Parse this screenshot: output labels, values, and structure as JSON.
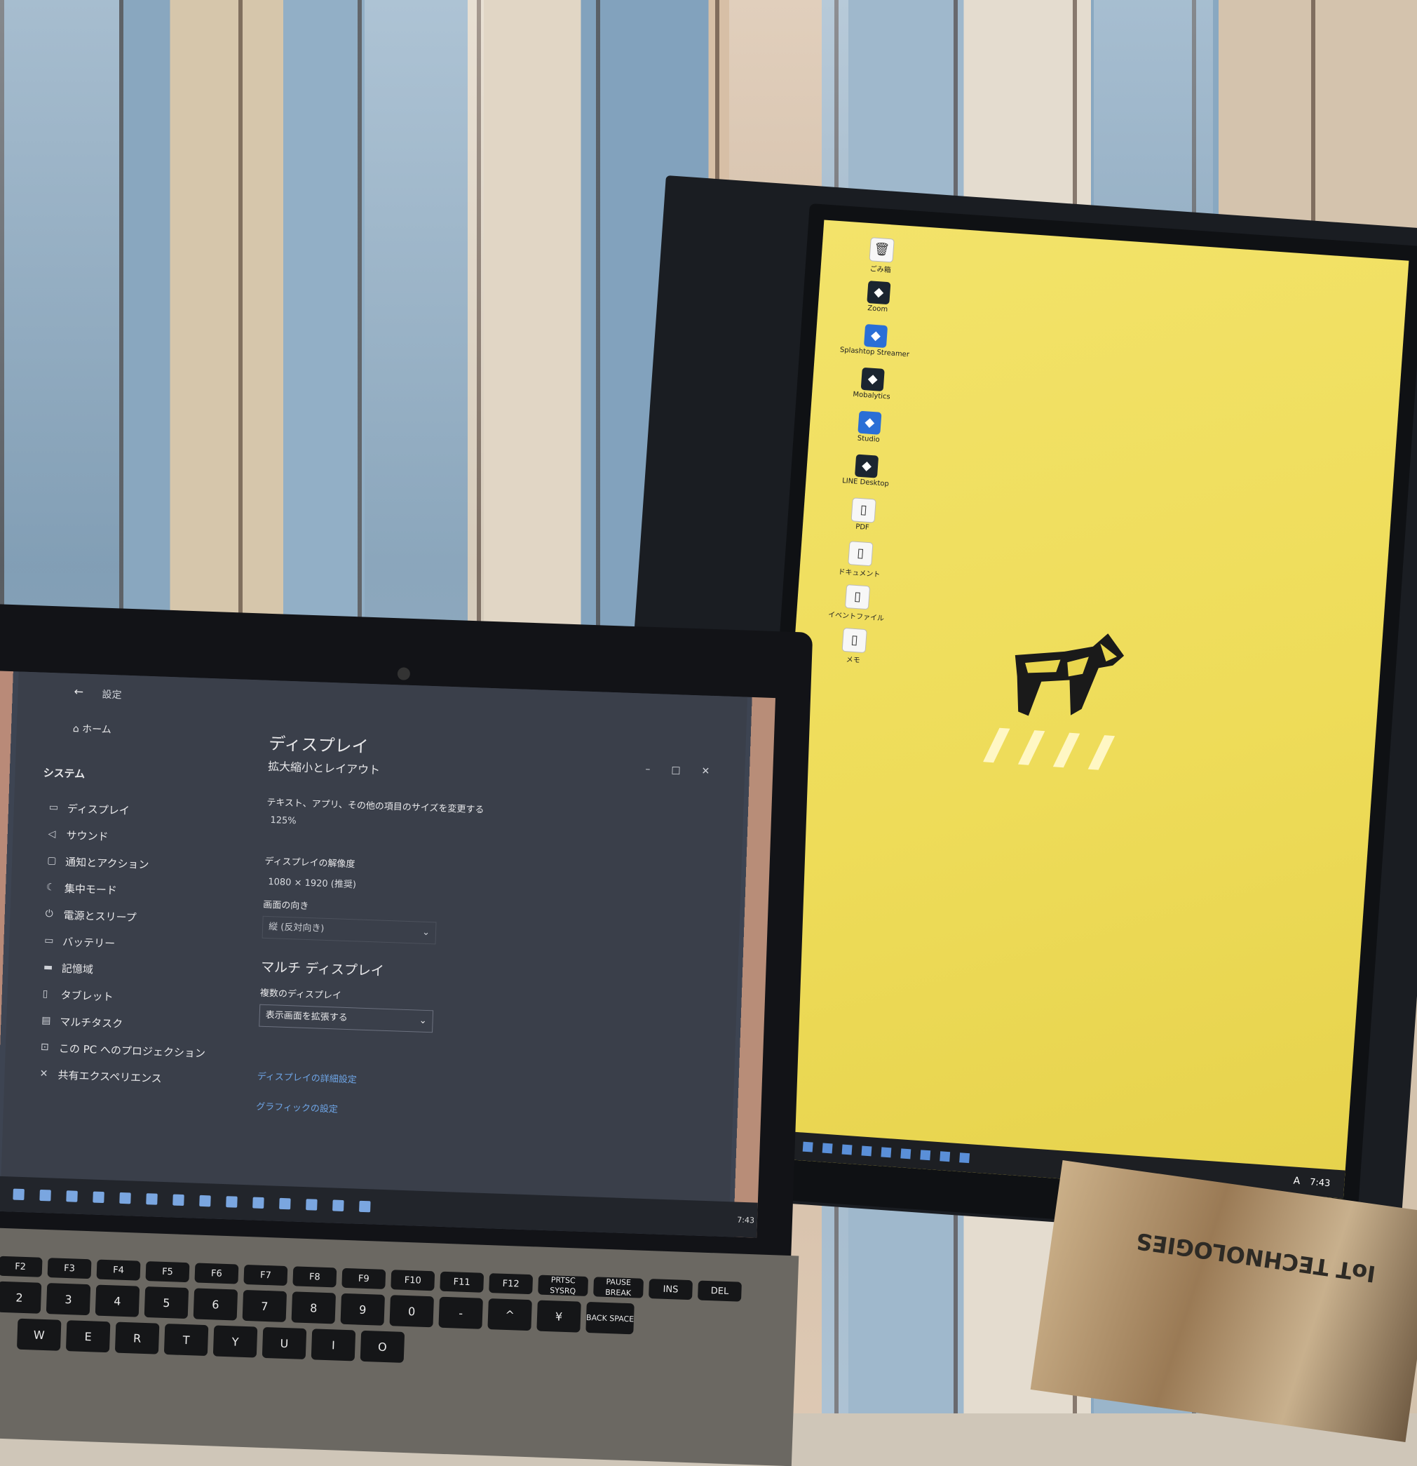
{
  "laptop": {
    "settings": {
      "window_title": "設定",
      "nav": {
        "home": "ホーム",
        "section": "システム",
        "items": [
          {
            "label": "ディスプレイ",
            "icon": "display-icon"
          },
          {
            "label": "サウンド",
            "icon": "speaker-icon"
          },
          {
            "label": "通知とアクション",
            "icon": "notification-icon"
          },
          {
            "label": "集中モード",
            "icon": "moon-icon"
          },
          {
            "label": "電源とスリープ",
            "icon": "power-icon"
          },
          {
            "label": "バッテリー",
            "icon": "battery-icon"
          },
          {
            "label": "記憶域",
            "icon": "storage-icon"
          },
          {
            "label": "タブレット",
            "icon": "tablet-icon"
          },
          {
            "label": "マルチタスク",
            "icon": "multitask-icon"
          },
          {
            "label": "この PC へのプロジェクション",
            "icon": "projection-icon"
          },
          {
            "label": "共有エクスペリエンス",
            "icon": "share-icon"
          }
        ]
      },
      "main": {
        "title": "ディスプレイ",
        "subtitle": "拡大縮小とレイアウト",
        "scale_label": "テキスト、アプリ、その他の項目のサイズを変更する",
        "scale_value": "125%",
        "resolution_label": "ディスプレイの解像度",
        "resolution_value": "1080 × 1920 (推奨)",
        "orientation_label": "画面の向き",
        "orientation_value": "縦 (反対向き)",
        "multi_title": "マルチ ディスプレイ",
        "multi_label": "複数のディスプレイ",
        "multi_value": "表示画面を拡張する",
        "link_advanced": "ディスプレイの詳細設定",
        "link_graphics": "グラフィックの設定"
      }
    },
    "taskbar": {
      "clock": "7:43"
    },
    "keyboard": {
      "fn_row": [
        "F2",
        "F3",
        "F4",
        "F5",
        "F6",
        "F7",
        "F8",
        "F9",
        "F10",
        "F11",
        "F12",
        "PRTSC SYSRQ",
        "PAUSE BREAK",
        "INS",
        "DEL"
      ],
      "num_row": [
        "2",
        "3",
        "4",
        "5",
        "6",
        "7",
        "8",
        "9",
        "0",
        "-",
        "^",
        "¥",
        "BACK SPACE"
      ],
      "q_row": [
        "W",
        "E",
        "R",
        "T",
        "Y",
        "U",
        "I",
        "O"
      ]
    }
  },
  "monitor": {
    "desktop_icons": [
      {
        "label": "ごみ箱",
        "icon": "recycle-bin-icon"
      },
      {
        "label": "Zoom",
        "icon": "zoom-icon"
      },
      {
        "label": "Splashtop Streamer",
        "icon": "hexagon-icon"
      },
      {
        "label": "Mobalytics",
        "icon": "app-icon"
      },
      {
        "label": "Studio",
        "icon": "app-icon"
      },
      {
        "label": "LINE Desktop",
        "icon": "app-icon"
      },
      {
        "label": "PDF",
        "icon": "file-icon"
      },
      {
        "label": "ドキュメント",
        "icon": "file-icon"
      },
      {
        "label": "イベントファイル",
        "icon": "file-icon"
      },
      {
        "label": "メモ",
        "icon": "file-icon"
      }
    ],
    "taskbar": {
      "clock": "7:43",
      "ime": "A"
    }
  },
  "books": {
    "spine": "IoT TECHNOLOGIES"
  }
}
